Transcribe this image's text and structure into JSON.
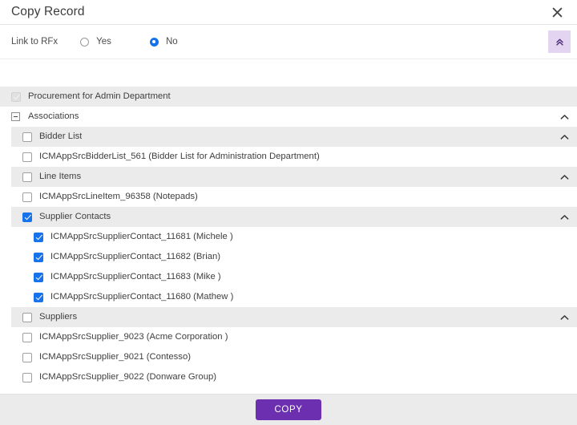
{
  "dialog": {
    "title": "Copy Record",
    "close_icon": "close-icon"
  },
  "toolbar": {
    "field_label": "Link to RFx",
    "options": [
      {
        "label": "Yes",
        "selected": false
      },
      {
        "label": "No",
        "selected": true
      }
    ],
    "collapse_icon": "double-chevron-up-icon"
  },
  "tree": {
    "rows": [
      {
        "label": "Procurement for Admin Department",
        "type": "section",
        "indent": 0,
        "checkbox": "disabled-checked",
        "expander": false,
        "chevron": false
      },
      {
        "label": "Associations",
        "type": "plain",
        "indent": 0,
        "checkbox": "none",
        "expander": true,
        "chevron": true
      },
      {
        "label": "Bidder List",
        "type": "section",
        "indent": 1,
        "checkbox": "unchecked",
        "expander": false,
        "chevron": true
      },
      {
        "label": "ICMAppSrcBidderList_561 (Bidder List for Administration Department)",
        "type": "leaf",
        "indent": 2,
        "checkbox": "unchecked",
        "expander": false,
        "chevron": false
      },
      {
        "label": "Line Items",
        "type": "section",
        "indent": 1,
        "checkbox": "unchecked",
        "expander": false,
        "chevron": true
      },
      {
        "label": "ICMAppSrcLineItem_96358 (Notepads)",
        "type": "leaf",
        "indent": 2,
        "checkbox": "unchecked",
        "expander": false,
        "chevron": false
      },
      {
        "label": "Supplier Contacts",
        "type": "section",
        "indent": 1,
        "checkbox": "checked",
        "expander": false,
        "chevron": true
      },
      {
        "label": "ICMAppSrcSupplierContact_11681 (Michele )",
        "type": "leaf",
        "indent": 3,
        "checkbox": "checked",
        "expander": false,
        "chevron": false
      },
      {
        "label": "ICMAppSrcSupplierContact_11682 (Brian)",
        "type": "leaf",
        "indent": 3,
        "checkbox": "checked",
        "expander": false,
        "chevron": false
      },
      {
        "label": "ICMAppSrcSupplierContact_11683 (Mike )",
        "type": "leaf",
        "indent": 3,
        "checkbox": "checked",
        "expander": false,
        "chevron": false
      },
      {
        "label": "ICMAppSrcSupplierContact_11680 (Mathew )",
        "type": "leaf",
        "indent": 3,
        "checkbox": "checked",
        "expander": false,
        "chevron": false
      },
      {
        "label": "Suppliers",
        "type": "section",
        "indent": 1,
        "checkbox": "unchecked",
        "expander": false,
        "chevron": true
      },
      {
        "label": "ICMAppSrcSupplier_9023 (Acme Corporation )",
        "type": "leaf",
        "indent": 2,
        "checkbox": "unchecked",
        "expander": false,
        "chevron": false
      },
      {
        "label": "ICMAppSrcSupplier_9021 (Contesso)",
        "type": "leaf",
        "indent": 2,
        "checkbox": "unchecked",
        "expander": false,
        "chevron": false
      },
      {
        "label": "ICMAppSrcSupplier_9022 (Donware Group)",
        "type": "leaf",
        "indent": 2,
        "checkbox": "unchecked",
        "expander": false,
        "chevron": false
      }
    ]
  },
  "footer": {
    "copy_label": "COPY"
  },
  "colors": {
    "accent_purple": "#6b2fb0",
    "collapse_bg": "#e3d4f2",
    "checkbox_blue": "#1673ec",
    "row_gray": "#ebebeb",
    "footer_gray": "#ebebeb"
  }
}
